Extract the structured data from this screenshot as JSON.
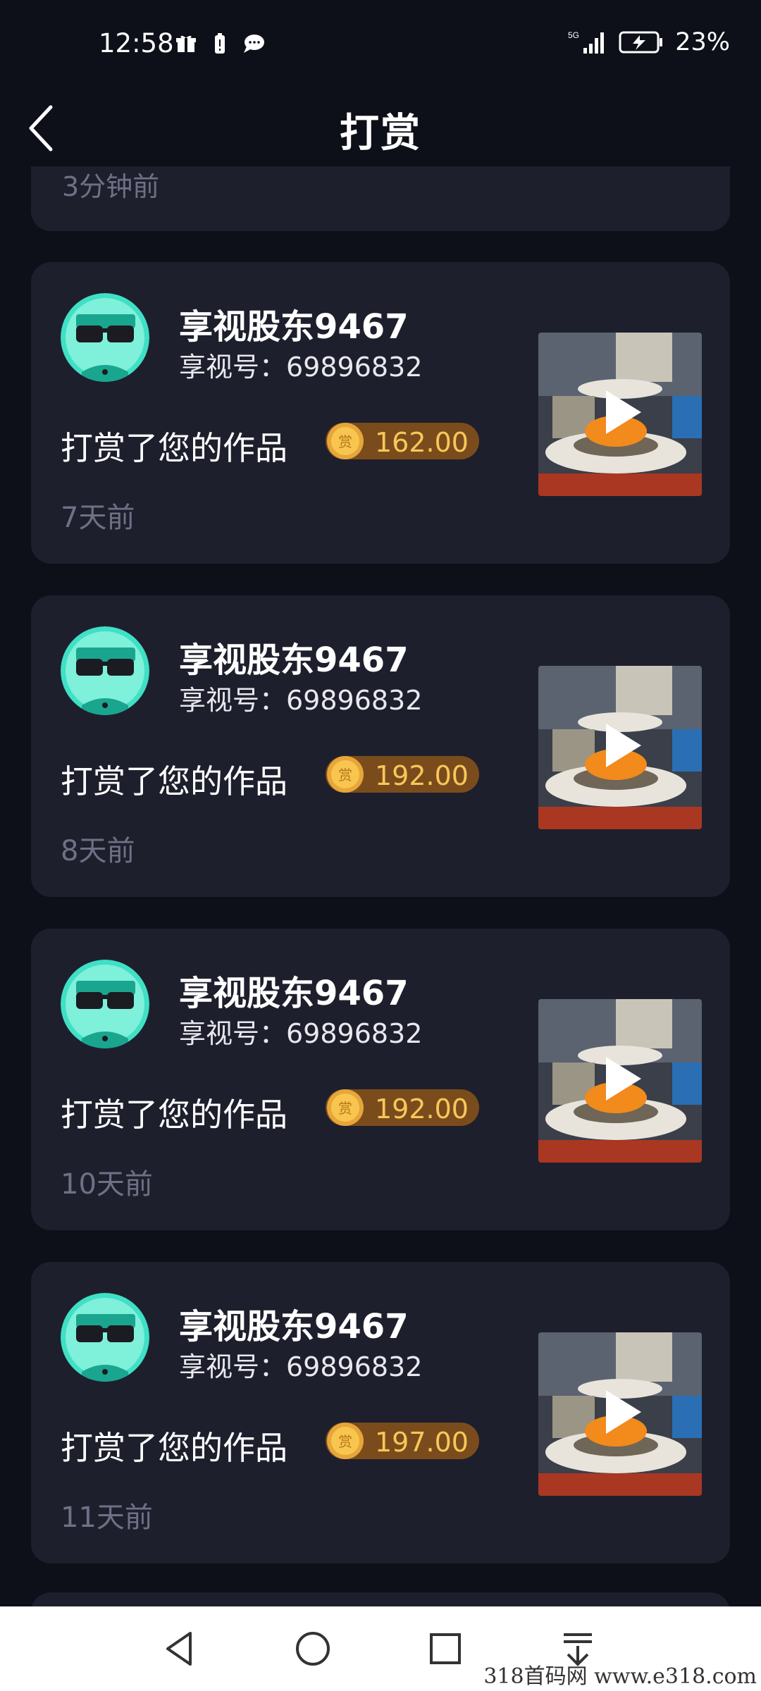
{
  "status": {
    "time": "12:58",
    "network": "5G",
    "battery": "23%"
  },
  "header": {
    "title": "打赏"
  },
  "partial": {
    "time_ago": "3分钟前"
  },
  "rewards": [
    {
      "username": "享视股东9467",
      "user_id": "享视号：69896832",
      "action": "打赏了您的作品",
      "amount": "162.00",
      "time_ago": "7天前"
    },
    {
      "username": "享视股东9467",
      "user_id": "享视号：69896832",
      "action": "打赏了您的作品",
      "amount": "192.00",
      "time_ago": "8天前"
    },
    {
      "username": "享视股东9467",
      "user_id": "享视号：69896832",
      "action": "打赏了您的作品",
      "amount": "192.00",
      "time_ago": "10天前"
    },
    {
      "username": "享视股东9467",
      "user_id": "享视号：69896832",
      "action": "打赏了您的作品",
      "amount": "197.00",
      "time_ago": "11天前"
    }
  ],
  "coin_icon_label": "赏",
  "colors": {
    "background": "#0d0f19",
    "card": "#1e1f2d",
    "coin_text": "#f7c75a",
    "coin_pill": "#7a4c1c",
    "avatar": "#3fe0c5",
    "muted_text": "#6e7085"
  },
  "icons": [
    "back-arrow-icon",
    "play-icon",
    "coin-icon",
    "nav-back-icon",
    "nav-home-icon",
    "nav-recents-icon",
    "nav-menu-icon"
  ],
  "watermark": "318首码网 www.e318.com"
}
